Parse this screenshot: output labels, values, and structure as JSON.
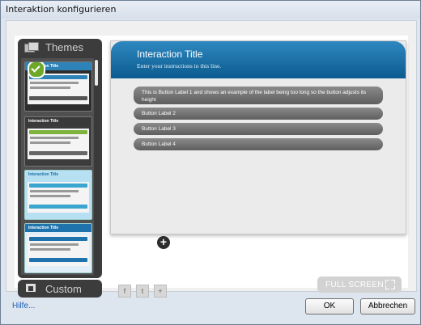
{
  "window": {
    "title": "Interaktion konfigurieren"
  },
  "themes": {
    "header_label": "Themes",
    "custom_label": "Custom",
    "thumbnails": [
      {
        "title": "Interaction Title",
        "accent": "#2d83b8",
        "selected": true
      },
      {
        "title": "Interaction Title",
        "accent": "#7db33c",
        "selected": false
      },
      {
        "title": "Interaction Title",
        "accent": "#3aa6cf",
        "selected": false
      },
      {
        "title": "Interaction Title",
        "accent": "#1e73ad",
        "selected": false
      }
    ]
  },
  "preview": {
    "title": "Interaction Title",
    "instructions": "Enter your instructions in this line.",
    "buttons": [
      "This is Button Label 1 and shows an example of the label being too long so the button adjusts its height",
      "Button Label 2",
      "Button Label 3",
      "Button Label 4"
    ],
    "title_color": "#1a6ea6"
  },
  "toolbar": {
    "full_screen_label": "FULL SCREEN"
  },
  "social": {
    "facebook": "f",
    "twitter": "t",
    "add": "+"
  },
  "footer": {
    "help_link": "Hilfe...",
    "ok_label": "OK",
    "cancel_label": "Abbrechen"
  }
}
